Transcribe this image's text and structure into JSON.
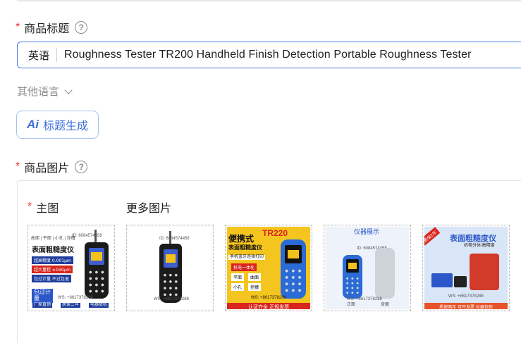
{
  "product_title": {
    "label": "商品标题",
    "required_mark": "*",
    "help_icon": "?",
    "language_tag": "英语",
    "value": "Roughness Tester TR200 Handheld Finish Detection Portable Roughness Tester"
  },
  "other_languages": {
    "label": "其他语言"
  },
  "ai_button": {
    "icon": "Ai",
    "label": "标题生成"
  },
  "product_images": {
    "label": "商品图片",
    "required_mark": "*",
    "help_icon": "?",
    "main_label": "主图",
    "more_label": "更多图片",
    "thumbs": [
      {
        "name": "main-image",
        "texts": {
          "header": "曲面 | 平面 | 小孔 | 深槽",
          "title": "表面粗糙度仪",
          "badge1": "超高精度 0.001μm",
          "badge2": "超大量程 ±160μm",
          "badge3": "包过计量 不过包退",
          "side": "包过计量",
          "footer1": "厂家直销",
          "footer2": "质保三年",
          "footer3": "电器联机",
          "wm": "ID: 6084574458",
          "ws": "WS: +8617378288"
        }
      },
      {
        "name": "more-image-1",
        "texts": {
          "wm": "ID: 6084574458",
          "ws": "WS: +8617378288"
        }
      },
      {
        "name": "more-image-2",
        "texts": {
          "model": "TR220",
          "title1": "便携式",
          "title2": "表面粗糙度仪",
          "sub": "手机蓝牙连接打印",
          "chip1": "机电一体化",
          "chip2": "平面",
          "chip3": "曲面",
          "chip4": "小孔",
          "chip5": "挖槽",
          "footer": "认证齐全 正规发票",
          "ws": "WS: +8617378288"
        }
      },
      {
        "name": "more-image-3",
        "texts": {
          "title": "仪器展示",
          "wm": "ID: 6084574458",
          "cap1": "正面",
          "cap2": "背面",
          "ws": "WS: +8617378288"
        }
      },
      {
        "name": "more-image-4",
        "texts": {
          "corner": "质保2年",
          "title": "表面粗糙度仪",
          "sub": "机电分体/高精度",
          "footer": "质保两年 可开发票 仪器包邮",
          "ws": "WS: +8617378288"
        }
      }
    ]
  },
  "colors": {
    "accent": "#3b6fd8",
    "required": "#e0393e",
    "input_border": "#4e7ce0",
    "muted": "#8c8c8c"
  },
  "icons": {
    "help": "question-circle-icon",
    "chevron": "chevron-down-icon",
    "ai": "ai-sparkle-icon"
  }
}
